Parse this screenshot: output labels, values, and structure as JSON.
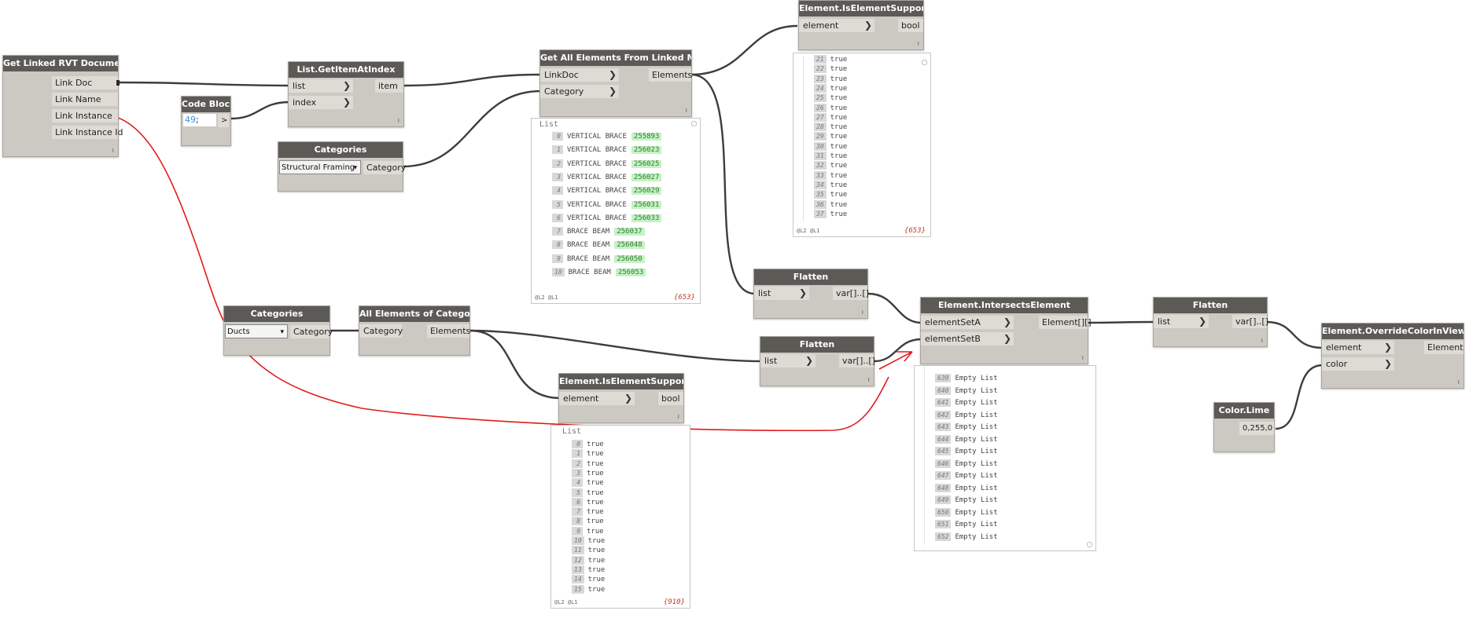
{
  "nodes": {
    "linked_docs": {
      "title": "Get Linked RVT Documents",
      "outputs": [
        "Link Doc",
        "Link Name",
        "Link Instance",
        "Link Instance Id"
      ]
    },
    "code_block": {
      "title": "Code Block",
      "code_number": "49",
      "code_rest": ";",
      "output": ">"
    },
    "get_item": {
      "title": "List.GetItemAtIndex",
      "inputs": [
        "list",
        "index"
      ],
      "output": "item"
    },
    "categories_1": {
      "title": "Categories",
      "selected": "Structural Framing",
      "output": "Category"
    },
    "get_all_linked": {
      "title": "Get All Elements From Linked Model",
      "inputs": [
        "LinkDoc",
        "Category"
      ],
      "output": "Elements"
    },
    "supported_top": {
      "title": "Element.IsElementSupported",
      "input": "element",
      "output": "bool"
    },
    "flatten_1": {
      "title": "Flatten",
      "input": "list",
      "output": "var[]..[]"
    },
    "categories_2": {
      "title": "Categories",
      "selected": "Ducts",
      "output": "Category"
    },
    "all_of_category": {
      "title": "All Elements of Category",
      "input": "Category",
      "output": "Elements"
    },
    "flatten_2": {
      "title": "Flatten",
      "input": "list",
      "output": "var[]..[]"
    },
    "supported_bottom": {
      "title": "Element.IsElementSupported",
      "input": "element",
      "output": "bool"
    },
    "intersects": {
      "title": "Element.IntersectsElement",
      "inputs": [
        "elementSetA",
        "elementSetB"
      ],
      "output": "Element[][]"
    },
    "flatten_3": {
      "title": "Flatten",
      "input": "list",
      "output": "var[]..[]"
    },
    "override_color": {
      "title": "Element.OverrideColorInView",
      "inputs": [
        "element",
        "color"
      ],
      "output": "Element"
    },
    "color_lime": {
      "title": "Color.Lime",
      "output": "0,255,0"
    }
  },
  "previews": {
    "linked_model": {
      "header": "List",
      "rows": [
        {
          "index": "0",
          "text": "VERTICAL BRACE",
          "id": "255893"
        },
        {
          "index": "1",
          "text": "VERTICAL BRACE",
          "id": "256023"
        },
        {
          "index": "2",
          "text": "VERTICAL BRACE",
          "id": "256025"
        },
        {
          "index": "3",
          "text": "VERTICAL BRACE",
          "id": "256027"
        },
        {
          "index": "4",
          "text": "VERTICAL BRACE",
          "id": "256029"
        },
        {
          "index": "5",
          "text": "VERTICAL BRACE",
          "id": "256031"
        },
        {
          "index": "6",
          "text": "VERTICAL BRACE",
          "id": "256033"
        },
        {
          "index": "7",
          "text": "BRACE BEAM",
          "id": "256037"
        },
        {
          "index": "8",
          "text": "BRACE BEAM",
          "id": "256048"
        },
        {
          "index": "9",
          "text": "BRACE BEAM",
          "id": "256050"
        },
        {
          "index": "10",
          "text": "BRACE BEAM",
          "id": "256053"
        }
      ],
      "levels": "@L2 @L1",
      "count": "{653}"
    },
    "supported_top": {
      "rows": [
        {
          "index": "21",
          "text": "true"
        },
        {
          "index": "22",
          "text": "true"
        },
        {
          "index": "23",
          "text": "true"
        },
        {
          "index": "24",
          "text": "true"
        },
        {
          "index": "25",
          "text": "true"
        },
        {
          "index": "26",
          "text": "true"
        },
        {
          "index": "27",
          "text": "true"
        },
        {
          "index": "28",
          "text": "true"
        },
        {
          "index": "29",
          "text": "true"
        },
        {
          "index": "30",
          "text": "true"
        },
        {
          "index": "31",
          "text": "true"
        },
        {
          "index": "32",
          "text": "true"
        },
        {
          "index": "33",
          "text": "true"
        },
        {
          "index": "34",
          "text": "true"
        },
        {
          "index": "35",
          "text": "true"
        },
        {
          "index": "36",
          "text": "true"
        },
        {
          "index": "37",
          "text": "true"
        }
      ],
      "levels": "@L2 @L1",
      "count": "{653}"
    },
    "supported_bottom": {
      "header": "List",
      "rows": [
        {
          "index": "0",
          "text": "true"
        },
        {
          "index": "1",
          "text": "true"
        },
        {
          "index": "2",
          "text": "true"
        },
        {
          "index": "3",
          "text": "true"
        },
        {
          "index": "4",
          "text": "true"
        },
        {
          "index": "5",
          "text": "true"
        },
        {
          "index": "6",
          "text": "true"
        },
        {
          "index": "7",
          "text": "true"
        },
        {
          "index": "8",
          "text": "true"
        },
        {
          "index": "9",
          "text": "true"
        },
        {
          "index": "10",
          "text": "true"
        },
        {
          "index": "11",
          "text": "true"
        },
        {
          "index": "12",
          "text": "true"
        },
        {
          "index": "13",
          "text": "true"
        },
        {
          "index": "14",
          "text": "true"
        },
        {
          "index": "15",
          "text": "true"
        }
      ],
      "levels": "@L2 @L1",
      "count": "{910}"
    },
    "intersects": {
      "rows": [
        {
          "index": "639",
          "text": "Empty List"
        },
        {
          "index": "640",
          "text": "Empty List"
        },
        {
          "index": "641",
          "text": "Empty List"
        },
        {
          "index": "642",
          "text": "Empty List"
        },
        {
          "index": "643",
          "text": "Empty List"
        },
        {
          "index": "644",
          "text": "Empty List"
        },
        {
          "index": "645",
          "text": "Empty List"
        },
        {
          "index": "646",
          "text": "Empty List"
        },
        {
          "index": "647",
          "text": "Empty List"
        },
        {
          "index": "648",
          "text": "Empty List"
        },
        {
          "index": "649",
          "text": "Empty List"
        },
        {
          "index": "650",
          "text": "Empty List"
        },
        {
          "index": "651",
          "text": "Empty List"
        },
        {
          "index": "652",
          "text": "Empty List"
        }
      ]
    }
  },
  "colors": {
    "canvas": "#ffffff",
    "node_body": "#ccc9c3",
    "node_title": "#5c5a56",
    "wire": "#3d3d3d",
    "annotation": "#e21b1b",
    "id_highlight": "#c6f2c5",
    "count_text": "#c03a2b"
  }
}
